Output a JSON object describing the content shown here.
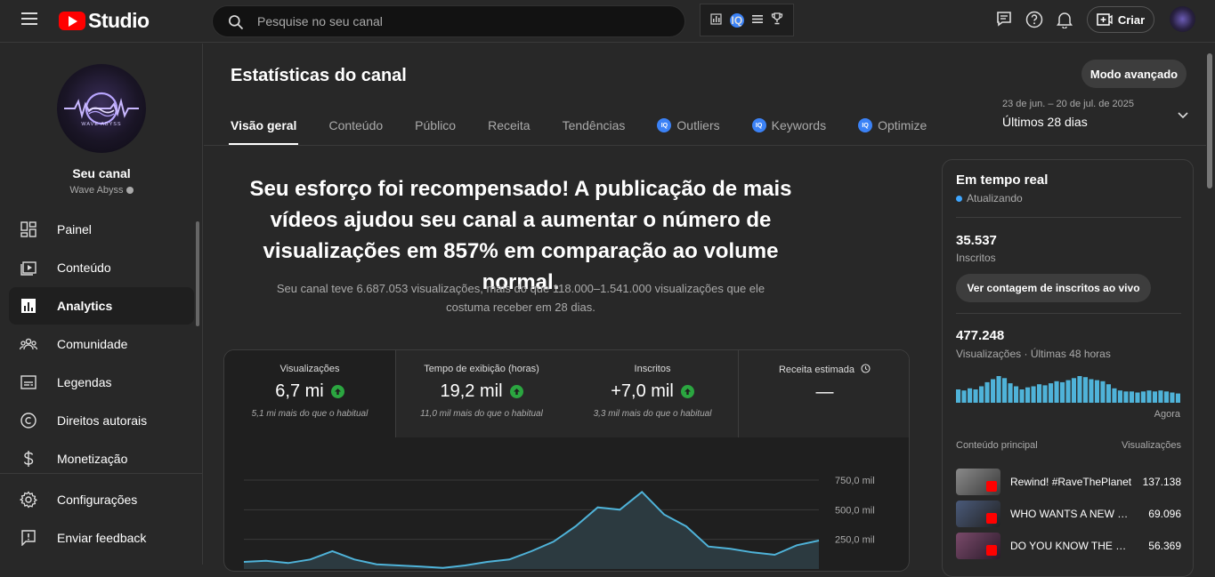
{
  "app": {
    "title": "Studio"
  },
  "search": {
    "placeholder": "Pesquise no seu canal"
  },
  "header": {
    "create_label": "Criar"
  },
  "channel": {
    "name_label": "Seu canal",
    "handle": "Wave Abyss",
    "logo_text": "WAVE ABYSS"
  },
  "sidebar": {
    "items": [
      {
        "label": "Painel",
        "icon": "dashboard-icon"
      },
      {
        "label": "Conteúdo",
        "icon": "content-icon"
      },
      {
        "label": "Analytics",
        "icon": "analytics-icon",
        "active": true
      },
      {
        "label": "Comunidade",
        "icon": "community-icon"
      },
      {
        "label": "Legendas",
        "icon": "subtitles-icon"
      },
      {
        "label": "Direitos autorais",
        "icon": "copyright-icon"
      },
      {
        "label": "Monetização",
        "icon": "dollar-icon"
      }
    ],
    "bottom": [
      {
        "label": "Configurações",
        "icon": "gear-icon"
      },
      {
        "label": "Enviar feedback",
        "icon": "feedback-icon"
      }
    ]
  },
  "page": {
    "title": "Estatísticas do canal",
    "advanced_label": "Modo avançado",
    "tabs": [
      {
        "label": "Visão geral"
      },
      {
        "label": "Conteúdo"
      },
      {
        "label": "Público"
      },
      {
        "label": "Receita"
      },
      {
        "label": "Tendências"
      },
      {
        "label": "Outliers",
        "ext": true
      },
      {
        "label": "Keywords",
        "ext": true
      },
      {
        "label": "Optimize",
        "ext": true
      }
    ],
    "date_range": "23 de jun. – 20 de jul. de 2025",
    "period": "Últimos 28 dias"
  },
  "overview": {
    "headline": "Seu esforço foi recompensado! A publicação de mais vídeos ajudou seu canal a aumentar o número de visualizações em 857% em comparação ao volume normal.",
    "subline": "Seu canal teve 6.687.053 visualizações, mais do que 118.000–1.541.000 visualizações que ele costuma receber em 28 dias."
  },
  "metrics": [
    {
      "label": "Visualizações",
      "value": "6,7 mi",
      "note": "5,1 mi mais do que o habitual",
      "up": true
    },
    {
      "label": "Tempo de exibição (horas)",
      "value": "19,2 mil",
      "note": "11,0 mil mais do que o habitual",
      "up": true
    },
    {
      "label": "Inscritos",
      "value": "+7,0 mil",
      "note": "3,3 mil mais do que o habitual",
      "up": true
    },
    {
      "label": "Receita estimada",
      "value": "—",
      "note": "",
      "up": false
    }
  ],
  "chart_data": {
    "type": "area",
    "title": "",
    "xlabel": "",
    "ylabel": "",
    "y_ticks": [
      "750,0 mil",
      "500,0 mil",
      "250,0 mil"
    ],
    "ylim": [
      0,
      750000
    ],
    "series": [
      {
        "values": [
          60000,
          70000,
          50000,
          80000,
          150000,
          80000,
          40000,
          30000,
          20000,
          10000,
          30000,
          60000,
          80000,
          150000,
          230000,
          360000,
          520000,
          500000,
          650000,
          460000,
          360000,
          190000,
          170000,
          140000,
          120000,
          200000,
          240000
        ]
      }
    ],
    "color": "#4fb3d9"
  },
  "realtime": {
    "title": "Em tempo real",
    "status": "Atualizando",
    "subscribers": "35.537",
    "subscribers_label": "Inscritos",
    "live_button": "Ver contagem de inscritos ao vivo",
    "views": "477.248",
    "views_label": "Visualizações · Últimas 48 horas",
    "now_label": "Agora",
    "bars": [
      13,
      12,
      14,
      13,
      16,
      20,
      23,
      26,
      24,
      19,
      16,
      13,
      15,
      16,
      18,
      17,
      19,
      21,
      20,
      22,
      24,
      26,
      25,
      23,
      22,
      21,
      18,
      14,
      12,
      11,
      11,
      10,
      11,
      12,
      11,
      12,
      11,
      10,
      9
    ],
    "top_header": "Conteúdo principal",
    "top_views_header": "Visualizações",
    "top_content": [
      {
        "title": "Rewind! #RaveThePlanet",
        "views": "137.138"
      },
      {
        "title": "WHO WANTS A NEW SET?",
        "views": "69.096"
      },
      {
        "title": "DO YOU KNOW THE ORIGINAL?",
        "views": "56.369"
      }
    ]
  }
}
